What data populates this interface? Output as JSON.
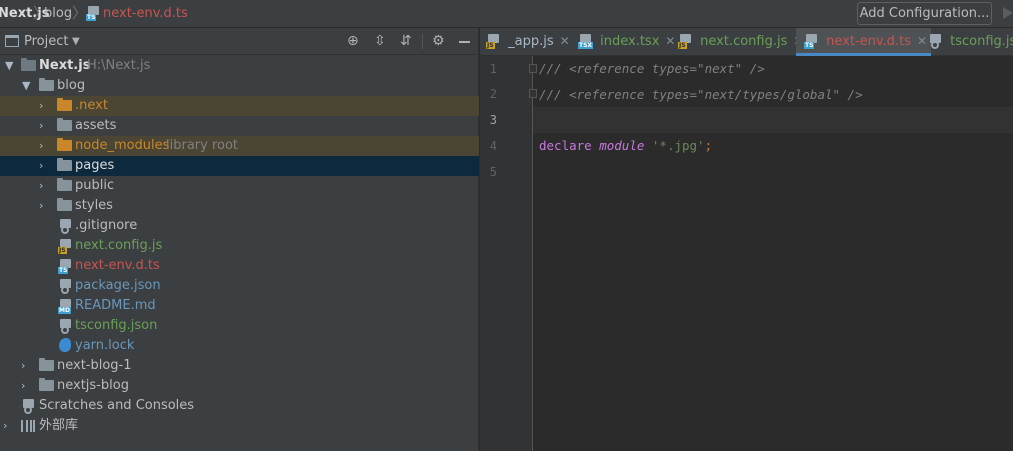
{
  "breadcrumb": {
    "project": "Next.js",
    "folder": "blog",
    "file": "next-env.d.ts"
  },
  "toolbar": {
    "add_configuration": "Add Configuration..."
  },
  "project_panel": {
    "title": "Project"
  },
  "tree": {
    "root": {
      "label": "Next.js",
      "path": "H:\\Next.js"
    },
    "blog": "blog",
    "next_dir": ".next",
    "assets": "assets",
    "node_modules": "node_modules",
    "node_modules_hint": "library root",
    "pages": "pages",
    "public": "public",
    "styles": "styles",
    "gitignore": ".gitignore",
    "next_config": "next.config.js",
    "next_env": "next-env.d.ts",
    "package_json": "package.json",
    "readme": "README.md",
    "tsconfig": "tsconfig.json",
    "yarn_lock": "yarn.lock",
    "next_blog_1": "next-blog-1",
    "nextjs_blog": "nextjs-blog",
    "scratches": "Scratches and Consoles",
    "external_libs": "外部库"
  },
  "tabs": [
    {
      "label": "_app.js",
      "type": "JS",
      "color": "#a9b7c6"
    },
    {
      "label": "index.tsx",
      "type": "TSX",
      "color": "#6a9f57"
    },
    {
      "label": "next.config.js",
      "type": "JS",
      "color": "#6a9f57"
    },
    {
      "label": "next-env.d.ts",
      "type": "TS",
      "color": "#c75450",
      "active": true
    },
    {
      "label": "tsconfig.json",
      "type": "JSON",
      "color": "#6a9f57"
    }
  ],
  "editor": {
    "line_numbers": [
      "1",
      "2",
      "3",
      "4",
      "5"
    ],
    "current_line": "3",
    "lines": {
      "l1": "/// <reference types=\"next\" />",
      "l2": "/// <reference types=\"next/types/global\" />",
      "l4_kw1": "declare",
      "l4_kw2": "module",
      "l4_str": "'*.jpg'",
      "l4_end": ";"
    }
  },
  "colors": {
    "modified_file": "#c75450",
    "added_file": "#6a9f57",
    "excluded_folder": "#c9872a",
    "selection": "#0d293e",
    "tab_underline": "#4a88c7"
  }
}
